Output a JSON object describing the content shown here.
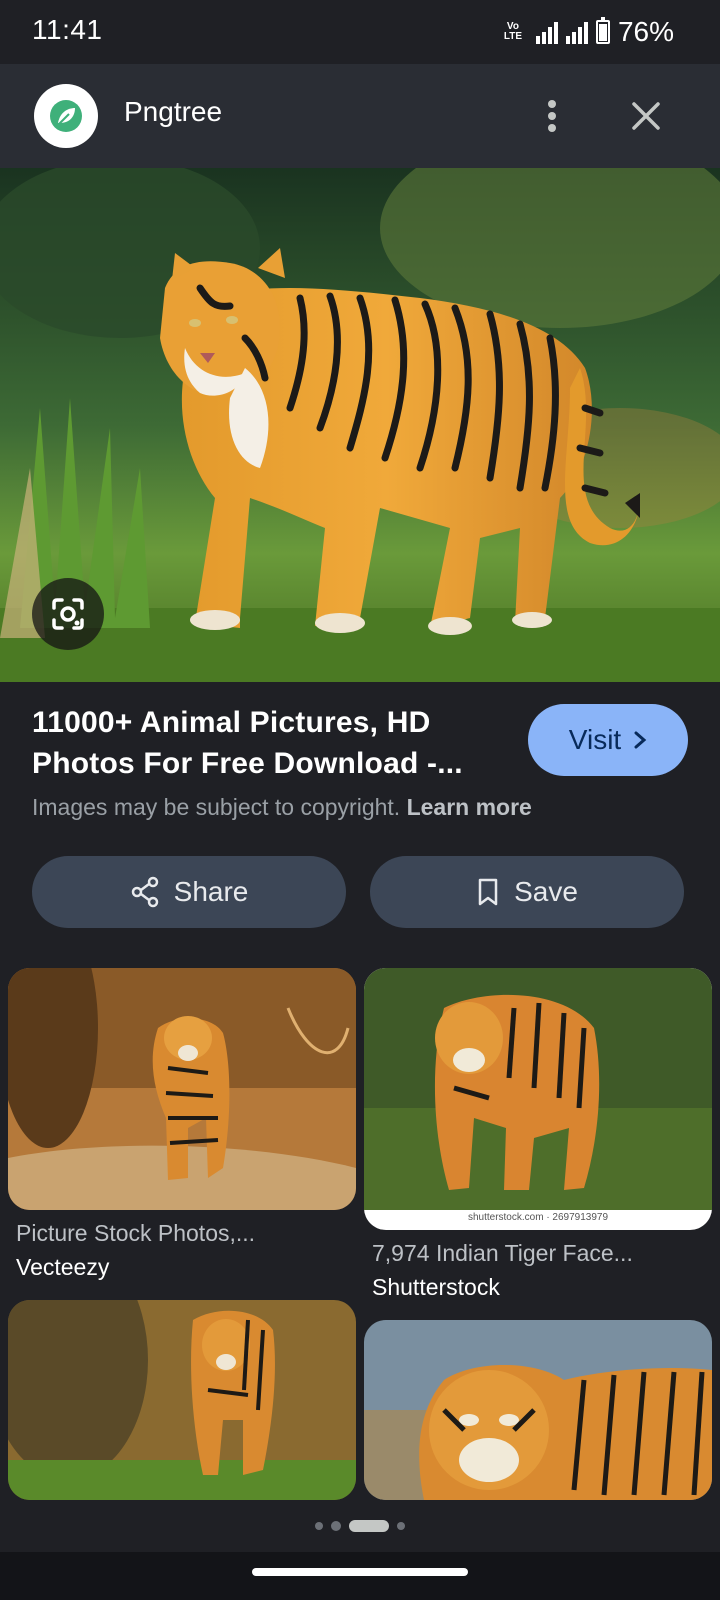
{
  "status_bar": {
    "time": "11:41",
    "network_label": "VoLTE2",
    "network_type": "4G",
    "battery": "76%",
    "battery_level": 0.76
  },
  "header": {
    "site_name": "Pngtree",
    "logo_icon": "pngtree-leaf-icon",
    "menu_icon": "more-vert-icon",
    "close_icon": "close-icon"
  },
  "result": {
    "title_line1": "11000+ Animal Pictures, HD",
    "title_line2": "Photos For Free Download -...",
    "visit_label": "Visit",
    "copyright_text": "Images may be subject to copyright.",
    "learn_more": "Learn more",
    "share_label": "Share",
    "save_label": "Save"
  },
  "related": [
    {
      "caption": "Picture Stock Photos,...",
      "source": "Vecteezy"
    },
    {
      "caption": "7,974 Indian Tiger Face...",
      "source": "Shutterstock",
      "watermark": "shutterstock.com · 2697913979"
    },
    {
      "caption": "",
      "source": ""
    },
    {
      "caption": "",
      "source": ""
    }
  ],
  "colors": {
    "background": "#1f2025",
    "header": "#2a2d34",
    "accent": "#8ab4f8",
    "button": "#3c4656"
  }
}
